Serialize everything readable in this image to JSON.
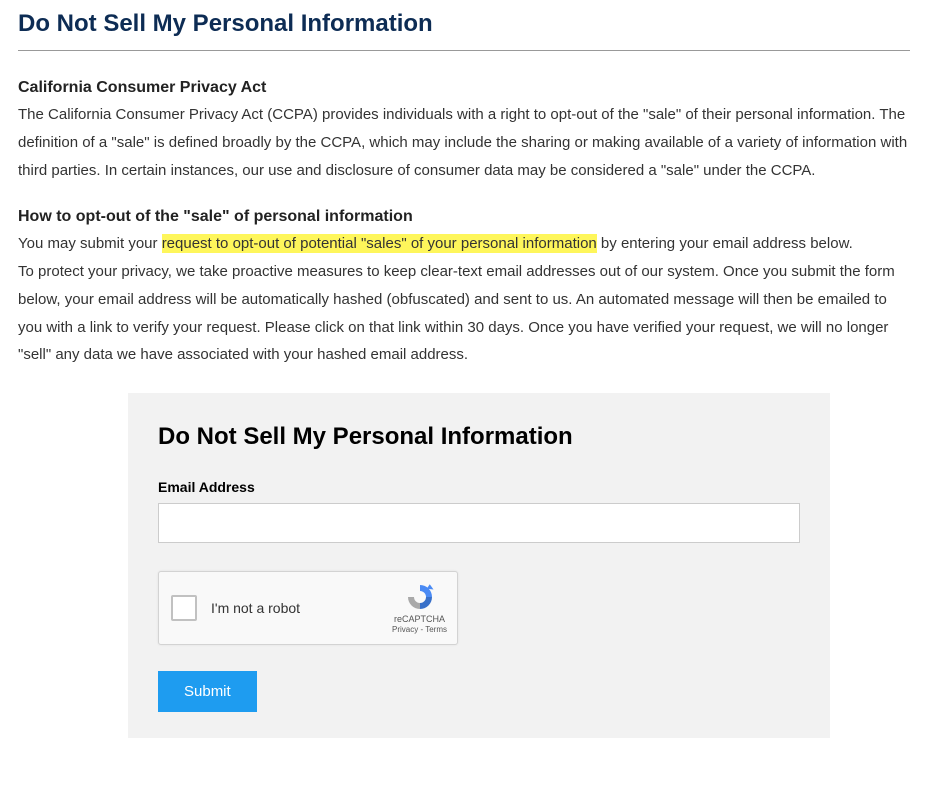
{
  "page": {
    "title": "Do Not Sell My Personal Information"
  },
  "section1": {
    "heading": "California Consumer Privacy Act",
    "body": "The California Consumer Privacy Act (CCPA) provides individuals with a right to opt-out of the \"sale\" of their personal information. The definition of a \"sale\" is defined broadly by the CCPA, which may include the sharing or making available of a variety of information with third parties. In certain instances, our use and disclosure of consumer data may be considered a \"sale\" under the CCPA."
  },
  "section2": {
    "heading": "How to opt-out of the \"sale\" of personal information",
    "line1_pre": "You may submit your ",
    "line1_highlight": "request to opt-out of potential \"sales\" of your personal information",
    "line1_post": " by entering your email address below.",
    "line2": "To protect your privacy, we take proactive measures to keep clear-text email addresses out of our system. Once you submit the form below, your email address will be automatically hashed (obfuscated) and sent to us. An automated message will then be emailed to you with a link to verify your request. Please click on that link within 30 days. Once you have verified your request, we will no longer \"sell\" any data we have associated with your hashed email address."
  },
  "form": {
    "title": "Do Not Sell My Personal Information",
    "email_label": "Email Address",
    "email_value": "",
    "recaptcha_label": "I'm not a robot",
    "recaptcha_brand": "reCAPTCHA",
    "recaptcha_privacy": "Privacy",
    "recaptcha_sep": " - ",
    "recaptcha_terms": "Terms",
    "submit_label": "Submit"
  }
}
